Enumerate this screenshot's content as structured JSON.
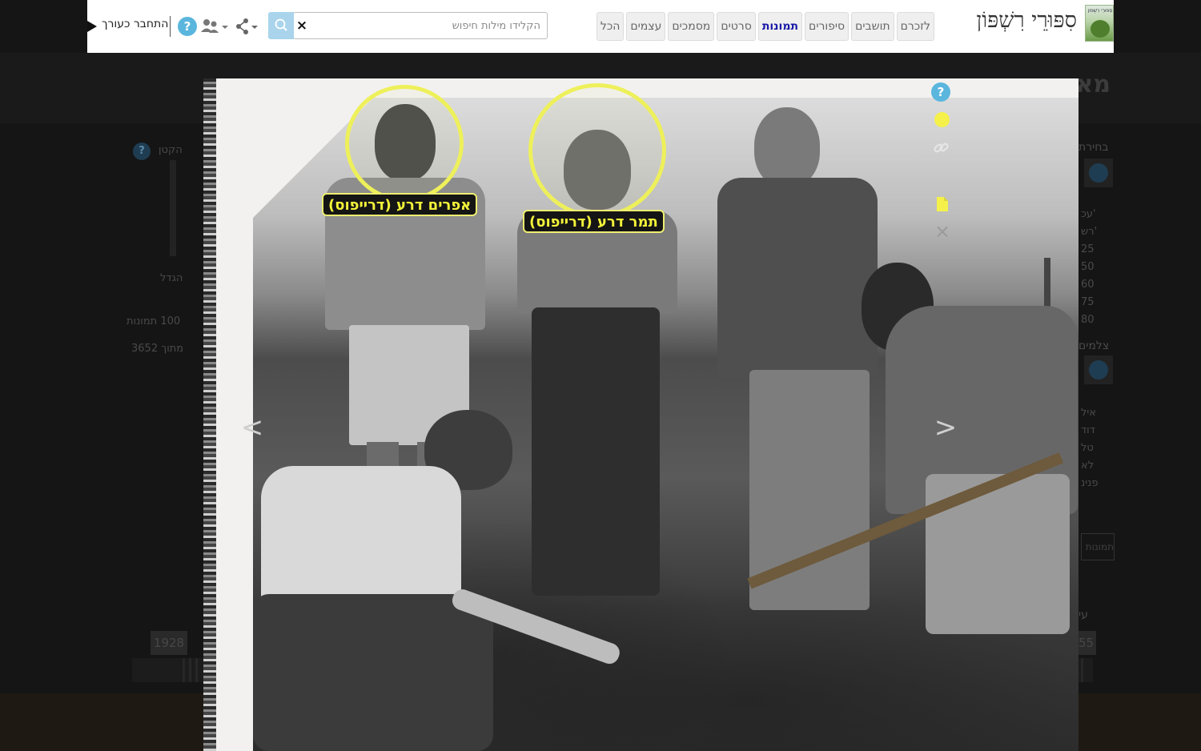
{
  "site": {
    "title": "סִפּוּרֵי רִשְׁפּוֹן",
    "logo_small_text": "סִפּוּרֵי רִשְׁפּוֹן"
  },
  "nav": {
    "tabs": [
      {
        "label": "לזכרם",
        "active": false
      },
      {
        "label": "תושבים",
        "active": false
      },
      {
        "label": "סיפורים",
        "active": false
      },
      {
        "label": "תמונות",
        "active": true
      },
      {
        "label": "סרטים",
        "active": false
      },
      {
        "label": "מסמכים",
        "active": false
      },
      {
        "label": "עצמים",
        "active": false
      },
      {
        "label": "הכל",
        "active": false
      }
    ]
  },
  "search": {
    "placeholder": "הקלידו מילות חיפוש",
    "value": "",
    "clear_label": "×"
  },
  "toolbar": {
    "help_label": "?",
    "login_label": "התחבר כעורך"
  },
  "background_page": {
    "heading": "מא",
    "left_panel": {
      "shrink_label": "הקטן",
      "help_label": "?",
      "enlarge_label": "הגדל",
      "photo_count_label": "100 תמונות",
      "total_label": "מתוך 3652"
    },
    "right_panel": {
      "select_label": "בחירת",
      "list_items": [
        "'עכ",
        "'רש",
        "25",
        "50",
        "60",
        "75",
        "80"
      ],
      "photographers_label": "צלמים",
      "text_lines": [
        "איל",
        "דוד",
        "טל",
        "לא",
        "פנינ"
      ],
      "photos_button_label": "תמונות",
      "era_label": "עי"
    },
    "timeline": {
      "start_year": "1928",
      "end_year": "55"
    }
  },
  "photo": {
    "tags": [
      {
        "name": "אפרים דרע (דרייפוס)"
      },
      {
        "name": "תמר דרע (דרייפוס)"
      }
    ],
    "prev_label": "<",
    "next_label": ">",
    "side_help_label": "?",
    "side_close_label": "×"
  },
  "colors": {
    "tag_yellow": "#f2f23a",
    "help_blue": "#5bb6de",
    "search_blue": "#a9d4ec",
    "active_tab": "#1a1aa8"
  },
  "icons": [
    "search-icon",
    "share-icon",
    "users-icon",
    "help-icon",
    "login-arrow-icon",
    "link-icon",
    "document-icon",
    "close-icon",
    "tag-dot-icon"
  ]
}
